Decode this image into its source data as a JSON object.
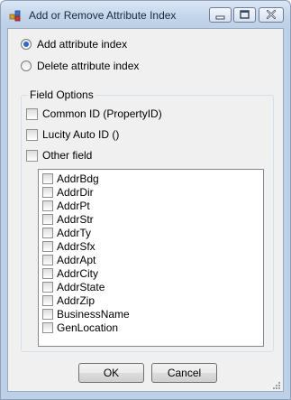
{
  "window": {
    "title": "Add or Remove Attribute Index"
  },
  "mode": {
    "add_label": "Add attribute index",
    "delete_label": "Delete attribute index",
    "selected": "add"
  },
  "field_options": {
    "group_label": "Field Options",
    "common_id_label": "Common ID (PropertyID)",
    "lucity_auto_id_label": "Lucity Auto ID ()",
    "other_field_label": "Other field",
    "fields": [
      "AddrBdg",
      "AddrDir",
      "AddrPt",
      "AddrStr",
      "AddrTy",
      "AddrSfx",
      "AddrApt",
      "AddrCity",
      "AddrState",
      "AddrZip",
      "BusinessName",
      "GenLocation"
    ]
  },
  "buttons": {
    "ok_label": "OK",
    "cancel_label": "Cancel"
  },
  "colors": {
    "radio_selected": "#2d6bc6",
    "close_button": "#c75050"
  }
}
